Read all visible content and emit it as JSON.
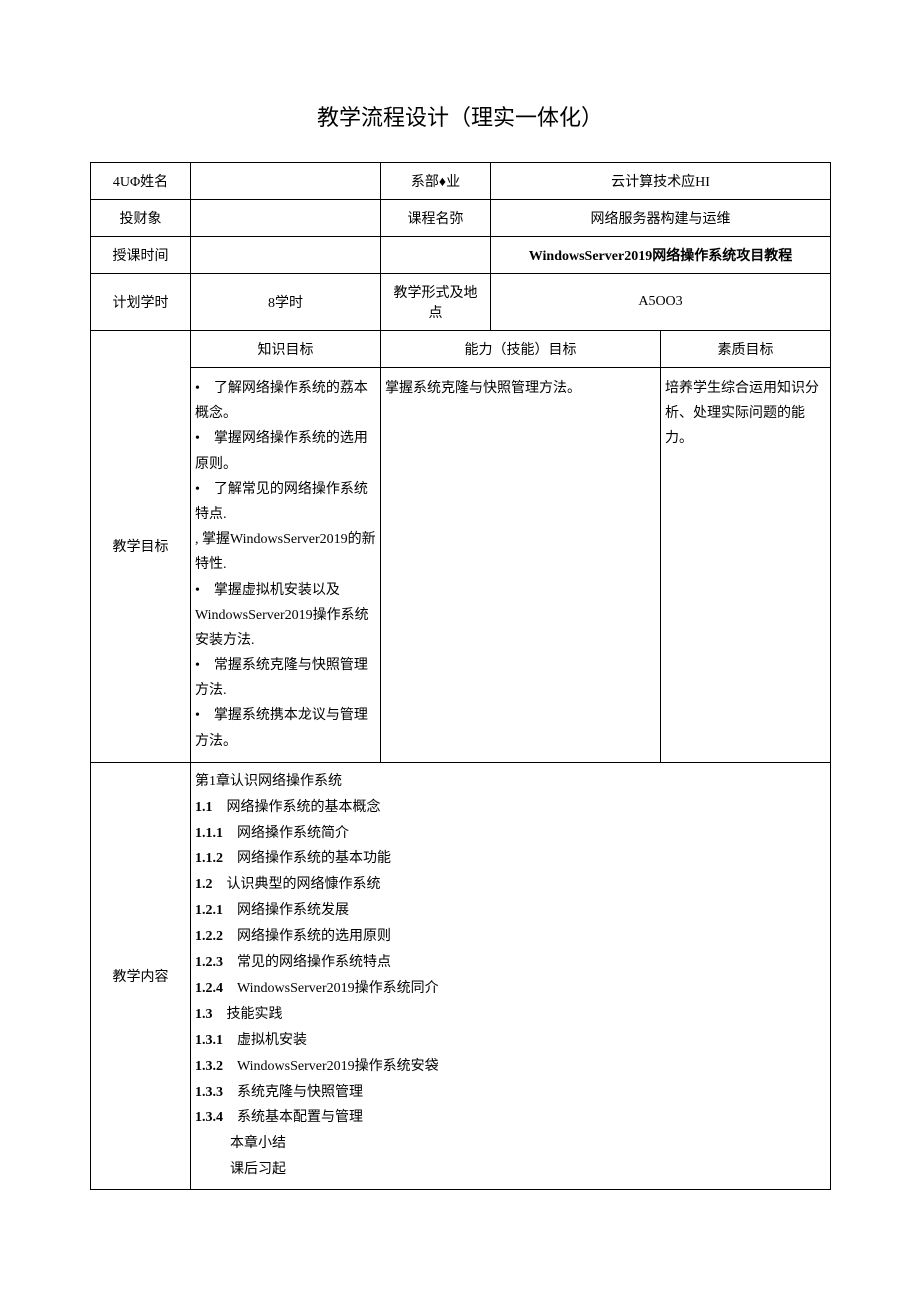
{
  "title": "教学流程设计（理实一体化）",
  "rows": {
    "teacher_label": "4UΦ姓名",
    "teacher_value": "",
    "dept_label": "系部♦业",
    "dept_value": "云计算技术应HI",
    "object_label": "投财象",
    "object_value": "",
    "course_label": "课程名弥",
    "course_value": "网络服务器构建与运维",
    "time_label": "授课时间",
    "time_value": "",
    "textbook_label": "",
    "textbook_value": "WindowsServer2019网络操作系统攻目教程",
    "hours_label": "计划学时",
    "hours_value": "8学时",
    "form_label": "教学形式及地点",
    "form_value": "A5OO3"
  },
  "goals": {
    "row_label": "教学目标",
    "headers": {
      "knowledge": "知识目标",
      "skill": "能力（技能）目标",
      "quality": "素质目标"
    },
    "knowledge_items": [
      "•　了解网络操作系统的荔本概念。",
      "•　掌握网络操作系统的选用原则。",
      "•　了解常见的网络操作系统特点.",
      ", 掌握WindowsServer2019的新特性.",
      "•　掌握虚拟机安装以及WindowsServer2019操作系统安装方法.",
      "•　常握系统克隆与快照管理方法.",
      "•　掌握系统携本龙议与管理方法。"
    ],
    "skill_text": "掌握系统克隆与快照管理方法。",
    "quality_text": "培养学生综合运用知识分析、处理实际问题的能力。"
  },
  "content": {
    "row_label": "教学内容",
    "lines": [
      {
        "num": "",
        "text": "第1章认识网络操作系统"
      },
      {
        "num": "1.1",
        "text": "网络操作系统的基本概念"
      },
      {
        "num": "1.1.1",
        "text": "网络搡作系统简介"
      },
      {
        "num": "1.1.2",
        "text": "网络操作系统的基本功能"
      },
      {
        "num": "1.2",
        "text": "认识典型的网络慷作系统"
      },
      {
        "num": "1.2.1",
        "text": "网络操作系统发展"
      },
      {
        "num": "1.2.2",
        "text": "网络操作系统的选用原则"
      },
      {
        "num": "1.2.3",
        "text": "常见的网络操作系统特点"
      },
      {
        "num": "1.2.4",
        "text": "WindowsServer2019操作系统同介"
      },
      {
        "num": "1.3",
        "text": "技能实践"
      },
      {
        "num": "1.3.1",
        "text": "虚拟机安装"
      },
      {
        "num": "1.3.2",
        "text": "WindowsServer2019操作系统安袋"
      },
      {
        "num": "1.3.3",
        "text": "系统克隆与快照管理"
      },
      {
        "num": "1.3.4",
        "text": "系统基本配置与管理"
      },
      {
        "num": "",
        "text": "本章小结",
        "indent": true
      },
      {
        "num": "",
        "text": "课后习起",
        "indent": true
      }
    ]
  }
}
